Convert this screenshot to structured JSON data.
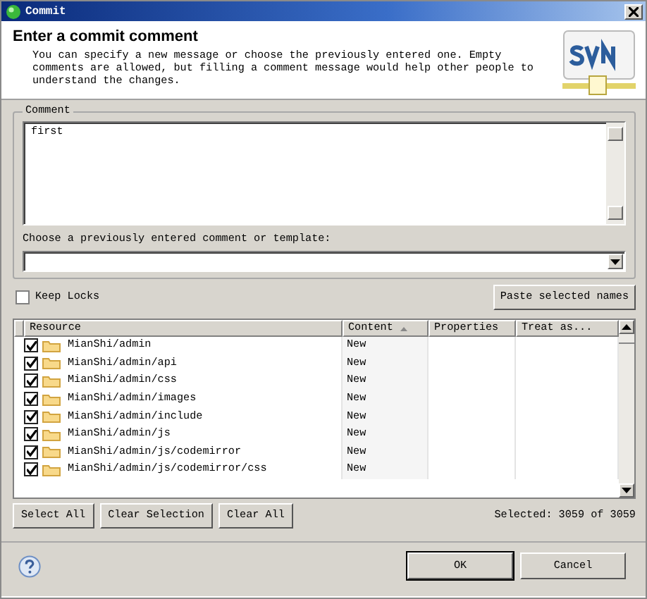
{
  "window": {
    "title": "Commit"
  },
  "header": {
    "title": "Enter a commit comment",
    "description": "You can specify a new message or choose the previously entered one. Empty comments are allowed, but filling a comment message would help other people to understand the changes."
  },
  "comment_group": {
    "legend": "Comment",
    "value": "first",
    "template_label": "Choose a previously entered comment or template:"
  },
  "keep_locks": {
    "label": "Keep Locks",
    "checked": false
  },
  "paste_button": "Paste selected names",
  "table": {
    "columns": [
      {
        "label": "Resource",
        "sorted": false
      },
      {
        "label": "Content",
        "sorted": true
      },
      {
        "label": "Properties",
        "sorted": false
      },
      {
        "label": "Treat as...",
        "sorted": false
      }
    ],
    "rows": [
      {
        "checked": true,
        "resource": "MianShi/admin",
        "content": "New"
      },
      {
        "checked": true,
        "resource": "MianShi/admin/api",
        "content": "New"
      },
      {
        "checked": true,
        "resource": "MianShi/admin/css",
        "content": "New"
      },
      {
        "checked": true,
        "resource": "MianShi/admin/images",
        "content": "New"
      },
      {
        "checked": true,
        "resource": "MianShi/admin/include",
        "content": "New"
      },
      {
        "checked": true,
        "resource": "MianShi/admin/js",
        "content": "New"
      },
      {
        "checked": true,
        "resource": "MianShi/admin/js/codemirror",
        "content": "New"
      },
      {
        "checked": true,
        "resource": "MianShi/admin/js/codemirror/css",
        "content": "New"
      }
    ]
  },
  "selection_buttons": [
    "Select All",
    "Clear Selection",
    "Clear All"
  ],
  "selected_count": "Selected: 3059 of 3059",
  "dialog_buttons": [
    {
      "label": "OK",
      "default": true
    },
    {
      "label": "Cancel",
      "default": false
    }
  ]
}
